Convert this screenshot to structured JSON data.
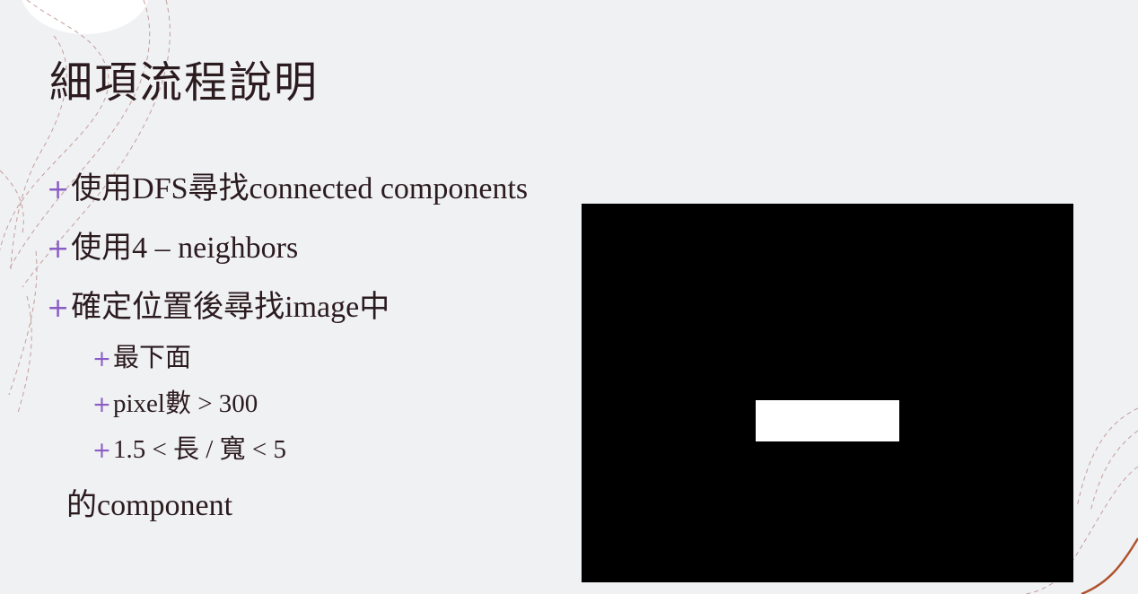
{
  "slide": {
    "title": "細項流程說明",
    "bullets": [
      "使用DFS尋找connected components",
      "使用4 – neighbors",
      "確定位置後尋找image中"
    ],
    "sub_bullets": [
      "最下面",
      "pixel數 > 300",
      "1.5 < 長 / 寬 < 5"
    ],
    "tail": "的component",
    "bullet_symbol": "+"
  },
  "colors": {
    "background": "#f0f1f3",
    "text": "#2b1b1f",
    "bullet_accent": "#8a5cc6",
    "image_background": "#000000",
    "image_object": "#ffffff",
    "decoration_lines": "#b98a86",
    "decoration_corner": "#b0532e"
  },
  "figure": {
    "description_icon": "binary-mask-image"
  }
}
